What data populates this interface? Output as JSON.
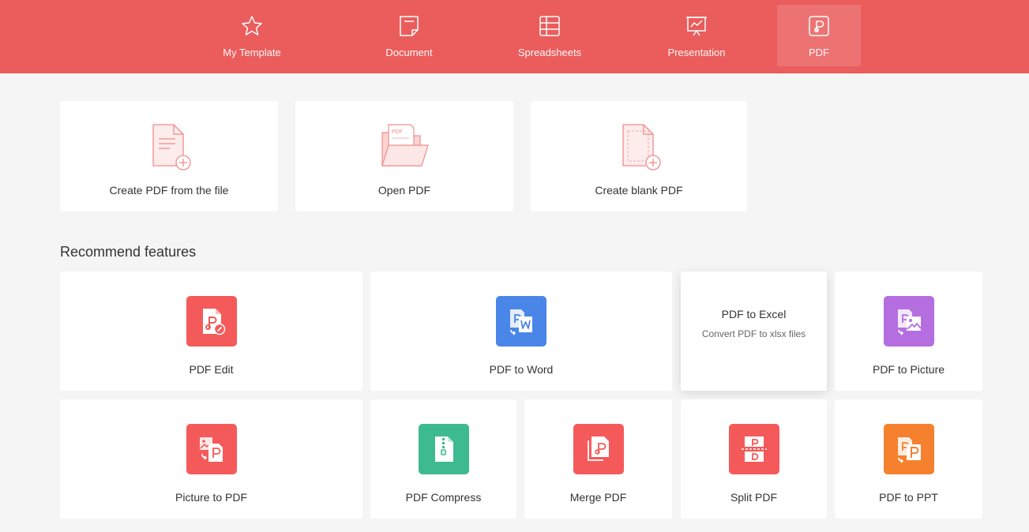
{
  "nav": {
    "tabs": [
      {
        "label": "My Template",
        "icon": "star-icon"
      },
      {
        "label": "Document",
        "icon": "document-icon"
      },
      {
        "label": "Spreadsheets",
        "icon": "spreadsheet-icon"
      },
      {
        "label": "Presentation",
        "icon": "presentation-icon"
      },
      {
        "label": "PDF",
        "icon": "pdf-icon"
      }
    ],
    "active": "PDF"
  },
  "quick_actions": [
    {
      "label": "Create PDF from the file",
      "icon": "file-plus-icon"
    },
    {
      "label": "Open PDF",
      "icon": "open-folder-icon"
    },
    {
      "label": "Create blank PDF",
      "icon": "blank-file-plus-icon"
    }
  ],
  "recommend": {
    "title": "Recommend features",
    "items": [
      {
        "label": "PDF Edit",
        "icon": "pdf-edit-icon",
        "color": "#f55a5a"
      },
      {
        "label": "PDF to Word",
        "icon": "pdf-to-word-icon",
        "color": "#4a86e8"
      },
      {
        "label": "PDF to Excel",
        "description": "Convert PDF to xlsx files",
        "icon": "pdf-to-excel-icon"
      },
      {
        "label": "PDF to Picture",
        "icon": "pdf-to-picture-icon",
        "color": "#b56ee0"
      },
      {
        "label": "Picture to PDF",
        "icon": "picture-to-pdf-icon",
        "color": "#f55a5a"
      },
      {
        "label": "PDF Compress",
        "icon": "pdf-compress-icon",
        "color": "#3dba8f"
      },
      {
        "label": "Merge PDF",
        "icon": "merge-pdf-icon",
        "color": "#f55a5a"
      },
      {
        "label": "Split PDF",
        "icon": "split-pdf-icon",
        "color": "#f55a5a"
      },
      {
        "label": "PDF to PPT",
        "icon": "pdf-to-ppt-icon",
        "color": "#f5812e"
      }
    ]
  },
  "colors": {
    "accent": "#ea5d5c",
    "background": "#f5f5f5"
  }
}
